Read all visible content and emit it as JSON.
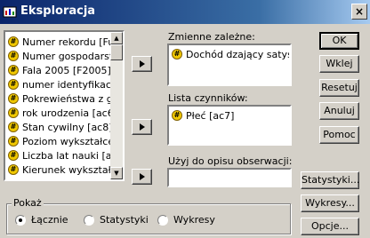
{
  "window": {
    "title": "Eksploracja",
    "close_glyph": "×"
  },
  "source_list": {
    "items": [
      "Numer rekordu [Ful",
      "Numer gospodarstw",
      "Fala 2005 [F2005]",
      "numer identyfikacy",
      "Pokrewieństwa z g",
      "rok urodzenia [ac6",
      "Stan cywilny [ac8]",
      "Poziom wykształce",
      "Liczba lat nauki [ac",
      "Kierunek wykształc"
    ]
  },
  "dependent": {
    "label": "Zmienne zależne:",
    "items": [
      "Dochód dzający satysfa"
    ]
  },
  "factors": {
    "label": "Lista czynników:",
    "items": [
      "Płeć [ac7]"
    ]
  },
  "case_label": {
    "label": "Użyj do opisu obserwacji:"
  },
  "buttons": {
    "ok": "OK",
    "paste": "Wklej",
    "reset": "Resetuj",
    "cancel": "Anuluj",
    "help": "Pomoc",
    "statistics": "Statystyki...",
    "plots": "Wykresy...",
    "options": "Opcje..."
  },
  "display": {
    "label": "Pokaż",
    "options": [
      "Łącznie",
      "Statystyki",
      "Wykresy"
    ],
    "selected": "Łącznie"
  }
}
